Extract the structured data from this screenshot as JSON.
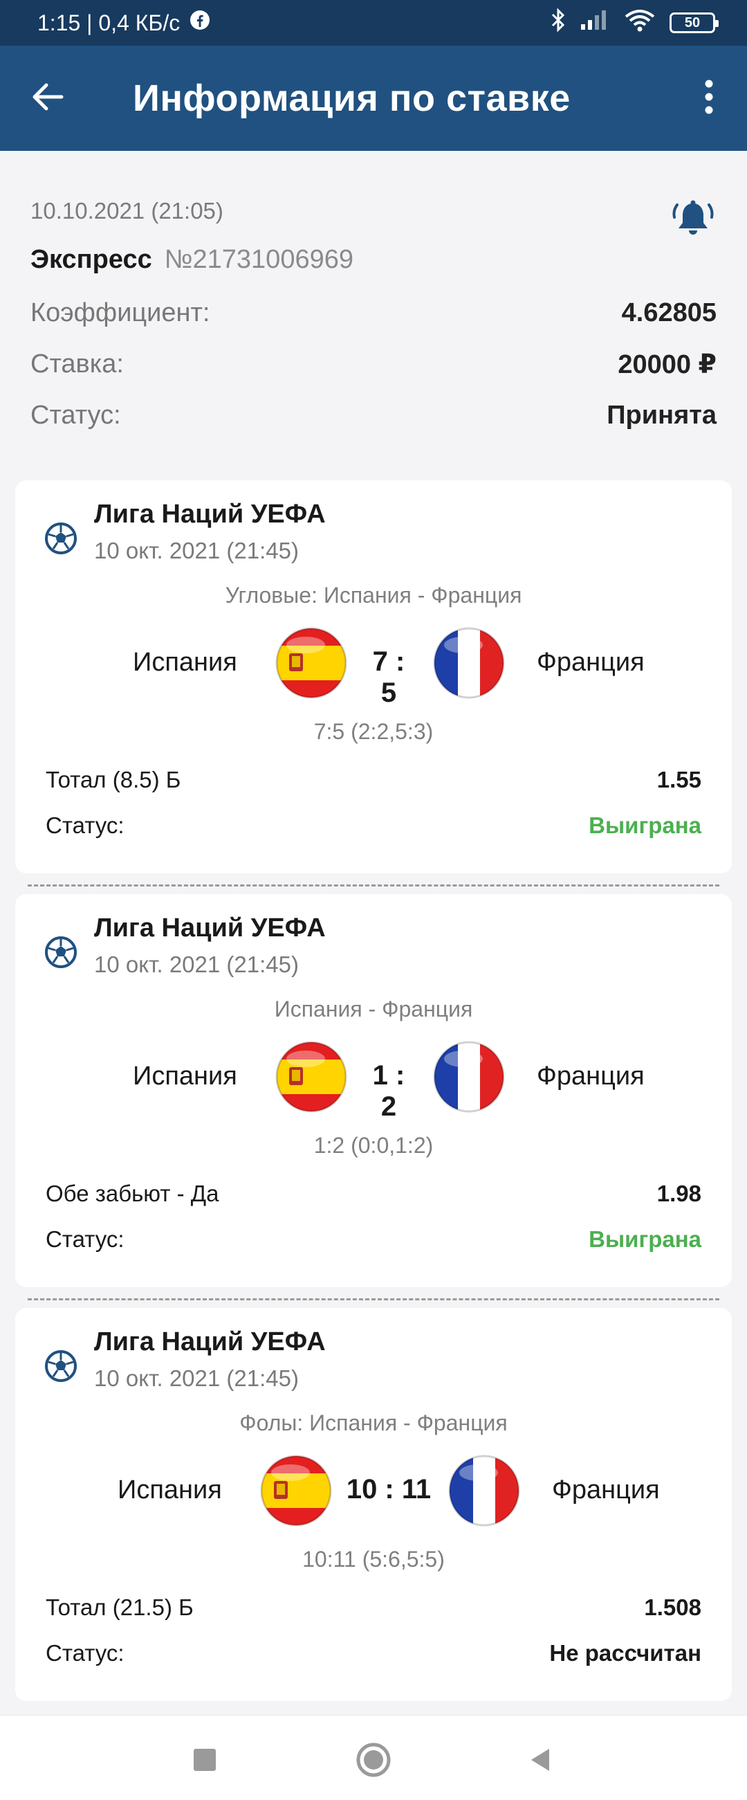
{
  "status_bar": {
    "time_net": "1:15 | 0,4 КБ/с",
    "battery": "50"
  },
  "app_bar": {
    "title": "Информация по ставке"
  },
  "bet": {
    "datetime": "10.10.2021 (21:05)",
    "type": "Экспресс",
    "number": "№21731006969",
    "rows": [
      {
        "label": "Коэффициент:",
        "value": "4.62805"
      },
      {
        "label": "Ставка:",
        "value": "20000 ₽"
      },
      {
        "label": "Статус:",
        "value": "Принята"
      }
    ]
  },
  "events": [
    {
      "league": "Лига Наций УЕФА",
      "date": "10 окт. 2021 (21:45)",
      "market": "Угловые: Испания - Франция",
      "home": "Испания",
      "away": "Франция",
      "score": "7 : 5",
      "detail": "7:5 (2:2,5:3)",
      "outcome": "Тотал (8.5) Б",
      "odds": "1.55",
      "status_label": "Статус:",
      "status": "Выиграна",
      "status_color": "#4caf50"
    },
    {
      "league": "Лига Наций УЕФА",
      "date": "10 окт. 2021 (21:45)",
      "market": "Испания - Франция",
      "home": "Испания",
      "away": "Франция",
      "score": "1 : 2",
      "detail": "1:2 (0:0,1:2)",
      "outcome": "Обе забьют - Да",
      "odds": "1.98",
      "status_label": "Статус:",
      "status": "Выиграна",
      "status_color": "#4caf50"
    },
    {
      "league": "Лига Наций УЕФА",
      "date": "10 окт. 2021 (21:45)",
      "market": "Фолы: Испания - Франция",
      "home": "Испания",
      "away": "Франция",
      "score": "10 : 11",
      "detail": "10:11 (5:6,5:5)",
      "outcome": "Тотал (21.5) Б",
      "odds": "1.508",
      "status_label": "Статус:",
      "status": "Не рассчитан",
      "status_color": "#1a1a1a"
    }
  ],
  "icons": {
    "back": "arrow-left-icon",
    "menu": "more-vert-icon",
    "bell": "bell-icon",
    "sport": "soccer-ball-icon",
    "flag_home": "spain-flag-icon",
    "flag_away": "france-flag-icon"
  },
  "colors": {
    "app_bar": "#205180",
    "status_bar": "#173a5e",
    "won": "#4caf50",
    "accent": "#205180"
  }
}
